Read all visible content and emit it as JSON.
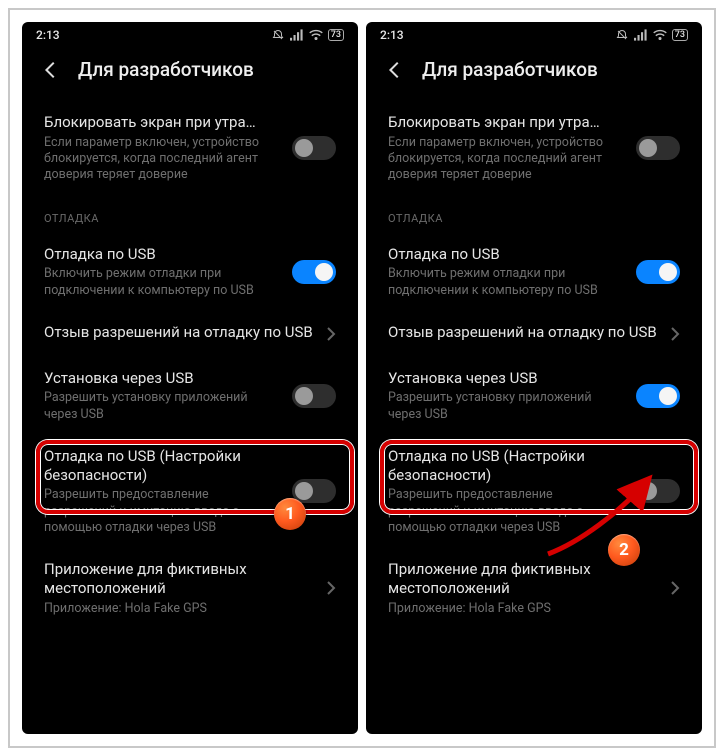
{
  "status": {
    "time": "2:13",
    "battery": "73"
  },
  "header": {
    "title": "Для разработчиков"
  },
  "rows": {
    "lock": {
      "title": "Блокировать экран при утра…",
      "desc": "Если параметр включен, устройство блокируется, когда последний агент доверия теряет доверие"
    },
    "section": "ОТЛАДКА",
    "usb_debug": {
      "title": "Отладка по USB",
      "desc": "Включить режим отладки при подключении к компьютеру по USB"
    },
    "revoke": {
      "title": "Отзыв разрешений на отладку по USB"
    },
    "install_usb": {
      "title": "Установка через USB",
      "desc": "Разрешить установку приложений через USB"
    },
    "usb_sec": {
      "title": "Отладка по USB (Настройки безопасности)",
      "desc": "Разрешить предоставление разрешений и имитацию ввода с помощью отладки через USB"
    },
    "mock_loc": {
      "title": "Приложение для фиктивных местоположений",
      "desc": "Приложение: Hola Fake GPS"
    }
  },
  "badges": {
    "b1": "1",
    "b2": "2"
  }
}
